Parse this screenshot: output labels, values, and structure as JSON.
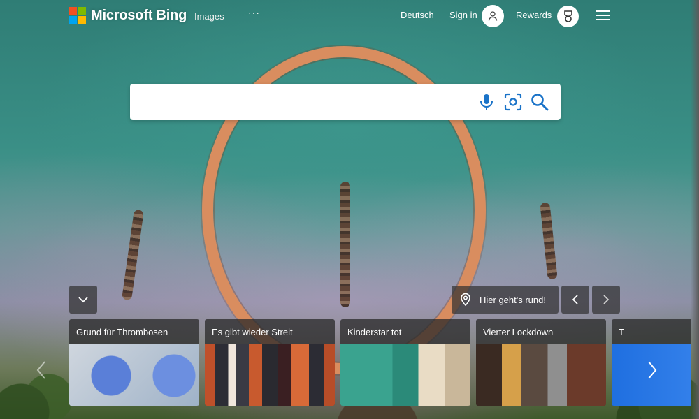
{
  "header": {
    "logo_text": "Microsoft Bing",
    "nav_images": "Images",
    "nav_more": "···",
    "language": "Deutsch",
    "sign_in": "Sign in",
    "rewards": "Rewards"
  },
  "search": {
    "placeholder": "",
    "value": ""
  },
  "hero": {
    "info_label": "Hier geht's rund!"
  },
  "news": [
    {
      "title": "Grund für Thrombosen"
    },
    {
      "title": "Es gibt wieder Streit"
    },
    {
      "title": "Kinderstar tot"
    },
    {
      "title": "Vierter Lockdown"
    },
    {
      "title": "T"
    }
  ],
  "colors": {
    "accent": "#0078d4",
    "ms_red": "#f25022",
    "ms_green": "#7fba00",
    "ms_blue": "#00a4ef",
    "ms_yellow": "#ffb900"
  }
}
